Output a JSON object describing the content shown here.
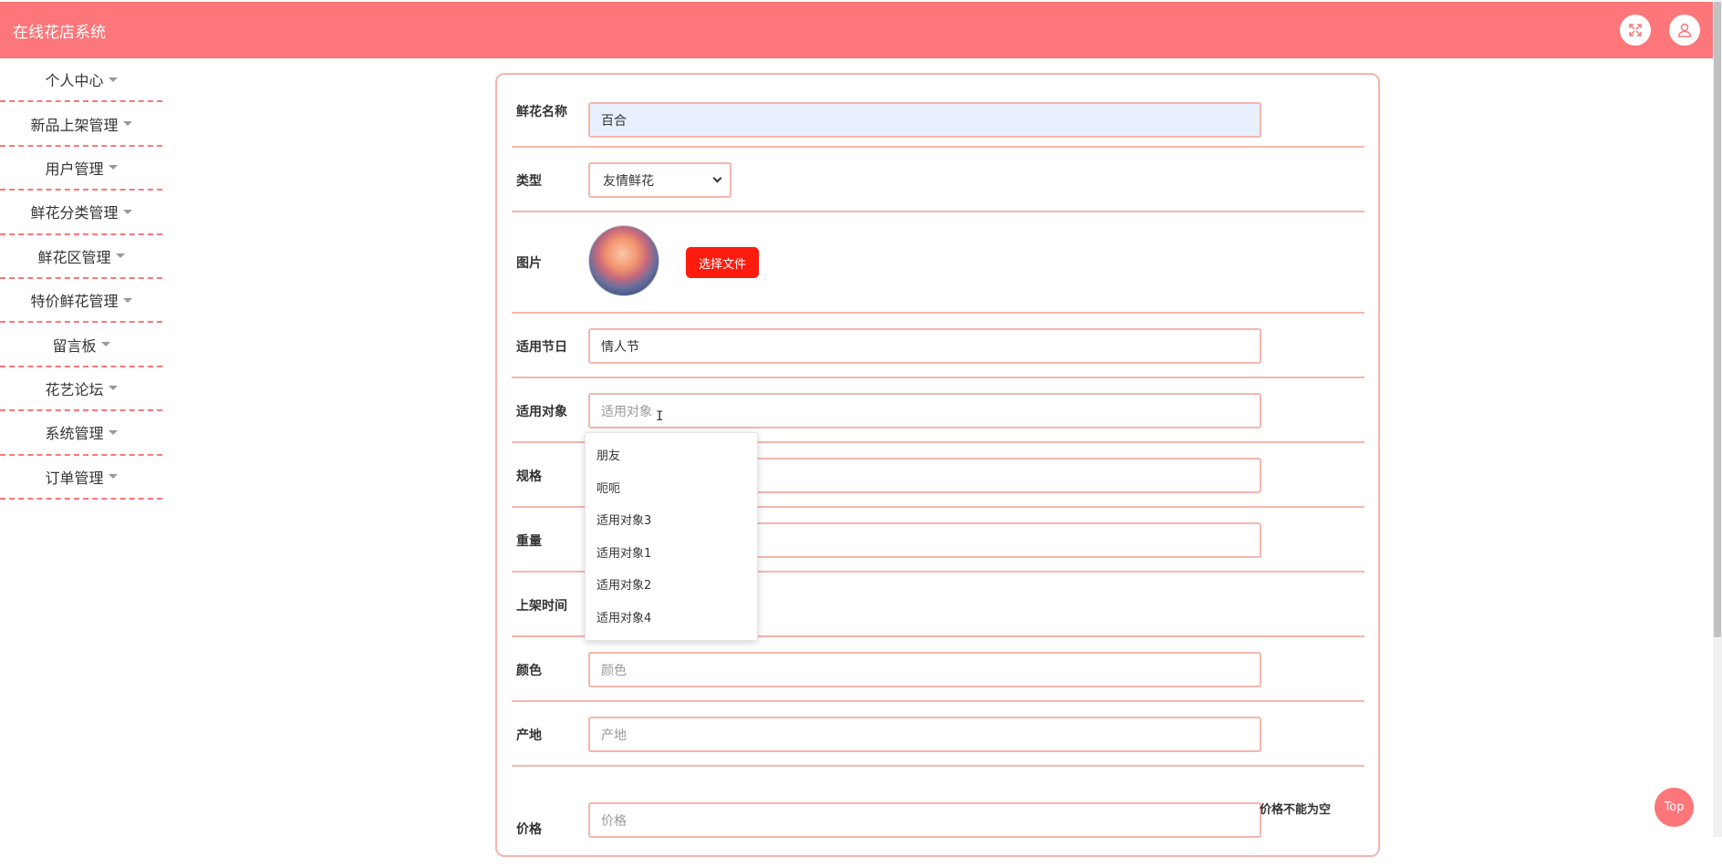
{
  "header": {
    "title": "在线花店系统",
    "fullscreen_icon": "fullscreen-icon",
    "user_icon": "user-icon"
  },
  "sidebar": {
    "items": [
      {
        "label": "个人中心"
      },
      {
        "label": "新品上架管理"
      },
      {
        "label": "用户管理"
      },
      {
        "label": "鲜花分类管理"
      },
      {
        "label": "鲜花区管理"
      },
      {
        "label": "特价鲜花管理"
      },
      {
        "label": "留言板"
      },
      {
        "label": "花艺论坛"
      },
      {
        "label": "系统管理"
      },
      {
        "label": "订单管理"
      }
    ]
  },
  "form": {
    "name_label": "鲜花名称",
    "name_value": "百合",
    "type_label": "类型",
    "type_value": "友情鲜花",
    "image_label": "图片",
    "file_button": "选择文件",
    "festival_label": "适用节日",
    "festival_value": "情人节",
    "target_label": "适用对象",
    "target_placeholder": "适用对象",
    "spec_label": "规格",
    "weight_label": "重量",
    "date_label": "上架时间",
    "color_label": "颜色",
    "color_placeholder": "颜色",
    "origin_label": "产地",
    "origin_placeholder": "产地",
    "price_label": "价格",
    "price_placeholder": "价格",
    "price_error": "价格不能为空"
  },
  "dropdown": {
    "options": [
      "朋友",
      "呃呃",
      "适用对象3",
      "适用对象1",
      "适用对象2",
      "适用对象4"
    ]
  },
  "top_button": "Top",
  "colors": {
    "header": "#fc767a",
    "border": "#f5b5ae",
    "file_button": "#ff1c0f"
  }
}
